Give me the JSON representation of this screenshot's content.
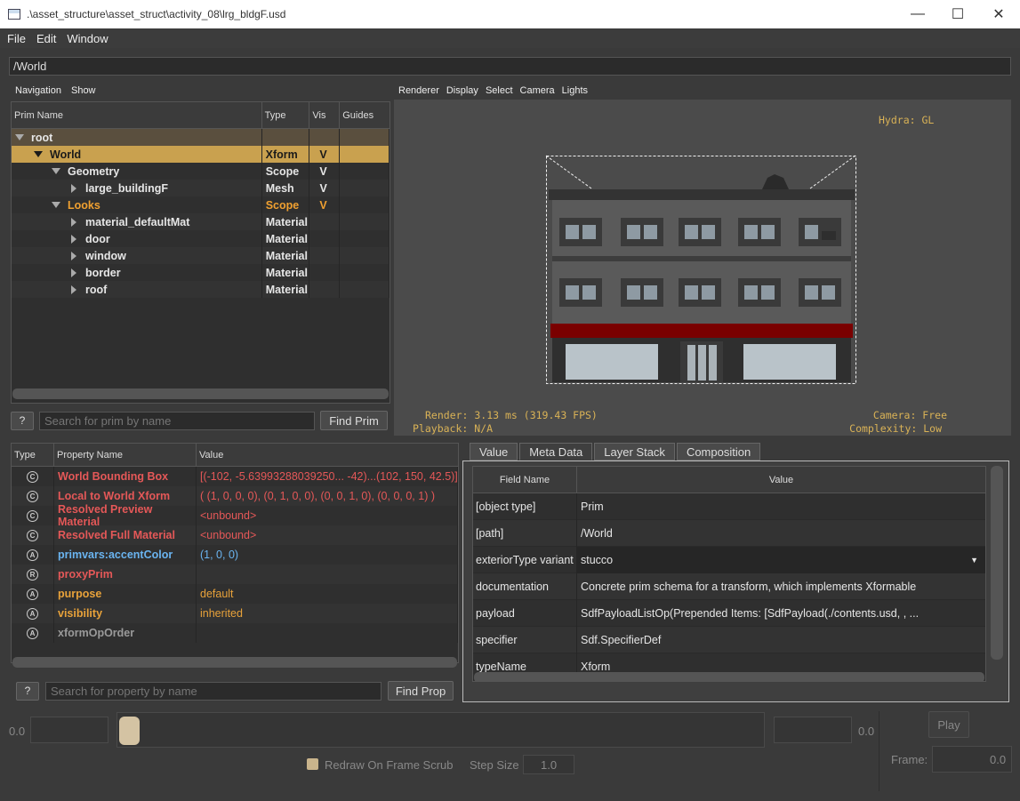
{
  "window": {
    "title": ".\\asset_structure\\asset_struct\\activity_08\\lrg_bldgF.usd",
    "minimize_glyph": "—",
    "maximize_glyph": "☐",
    "close_glyph": "✕"
  },
  "menu": {
    "file": "File",
    "edit": "Edit",
    "window": "Window"
  },
  "path": "/World",
  "tree_panel": {
    "nav_label": "Navigation",
    "show_label": "Show",
    "columns": {
      "name": "Prim Name",
      "type": "Type",
      "vis": "Vis",
      "guides": "Guides"
    },
    "rows": [
      {
        "name": "root",
        "type": "",
        "vis": ""
      },
      {
        "name": "World",
        "type": "Xform",
        "vis": "V"
      },
      {
        "name": "Geometry",
        "type": "Scope",
        "vis": "V"
      },
      {
        "name": "large_buildingF",
        "type": "Mesh",
        "vis": "V"
      },
      {
        "name": "Looks",
        "type": "Scope",
        "vis": "V"
      },
      {
        "name": "material_defaultMat",
        "type": "Material",
        "vis": ""
      },
      {
        "name": "door",
        "type": "Material",
        "vis": ""
      },
      {
        "name": "window",
        "type": "Material",
        "vis": ""
      },
      {
        "name": "border",
        "type": "Material",
        "vis": ""
      },
      {
        "name": "roof",
        "type": "Material",
        "vis": ""
      }
    ],
    "help": "?",
    "search_placeholder": "Search for prim by name",
    "find_button": "Find Prim"
  },
  "viewport": {
    "menus": {
      "renderer": "Renderer",
      "display": "Display",
      "select": "Select",
      "camera": "Camera",
      "lights": "Lights"
    },
    "hud_hydra": "Hydra: GL",
    "hud_render": "Render: 3.13 ms (319.43 FPS)",
    "hud_playback": "Playback: N/A",
    "hud_camera": "Camera: Free",
    "hud_complexity": "Complexity: Low"
  },
  "properties": {
    "columns": {
      "type": "Type",
      "name": "Property Name",
      "value": "Value"
    },
    "rows": [
      {
        "icon": "C",
        "name": "World Bounding Box",
        "value": "[(-102, -5.63993288039250... -42)...(102, 150, 42.5)]",
        "color": "red"
      },
      {
        "icon": "C",
        "name": "Local to World Xform",
        "value": "( (1, 0, 0, 0), (0, 1, 0, 0), (0, 0, 1, 0), (0, 0, 0, 1) )",
        "color": "red"
      },
      {
        "icon": "C",
        "name": "Resolved Preview Material",
        "value": "<unbound>",
        "color": "red"
      },
      {
        "icon": "C",
        "name": "Resolved Full Material",
        "value": "<unbound>",
        "color": "red"
      },
      {
        "icon": "A",
        "name": "primvars:accentColor",
        "value": "(1, 0, 0)",
        "color": "blue"
      },
      {
        "icon": "R",
        "name": "proxyPrim",
        "value": "",
        "color": "red"
      },
      {
        "icon": "A",
        "name": "purpose",
        "value": "default",
        "color": "orange"
      },
      {
        "icon": "A",
        "name": "visibility",
        "value": "inherited",
        "color": "orange"
      },
      {
        "icon": "A",
        "name": "xformOpOrder",
        "value": "",
        "color": "grey"
      }
    ],
    "help": "?",
    "search_placeholder": "Search for property by name",
    "find_button": "Find Prop"
  },
  "meta": {
    "tabs": [
      "Value",
      "Meta Data",
      "Layer Stack",
      "Composition"
    ],
    "columns": {
      "field": "Field Name",
      "value": "Value"
    },
    "rows": [
      {
        "field": "[object type]",
        "value": "Prim"
      },
      {
        "field": "[path]",
        "value": "/World"
      },
      {
        "field": "exteriorType variant",
        "value": "stucco"
      },
      {
        "field": "documentation",
        "value": "Concrete prim schema for a transform, which implements Xformable"
      },
      {
        "field": "payload",
        "value": "SdfPayloadListOp(Prepended Items: [SdfPayload(./contents.usd, , ..."
      },
      {
        "field": "specifier",
        "value": "Sdf.SpecifierDef"
      },
      {
        "field": "typeName",
        "value": "Xform"
      }
    ]
  },
  "timeline": {
    "start": "0.0",
    "end": "0.0",
    "play": "Play",
    "redraw_label": "Redraw On Frame Scrub",
    "step_label": "Step Size",
    "step_value": "1.0",
    "frame_label": "Frame:",
    "frame_value": "0.0"
  },
  "colors": {
    "selection": "#c9a14f",
    "hud": "#d9b256",
    "computed_prop": "#e55858",
    "authored_prop": "#6ab4f0",
    "fallback_prop": "#e8a23a"
  }
}
